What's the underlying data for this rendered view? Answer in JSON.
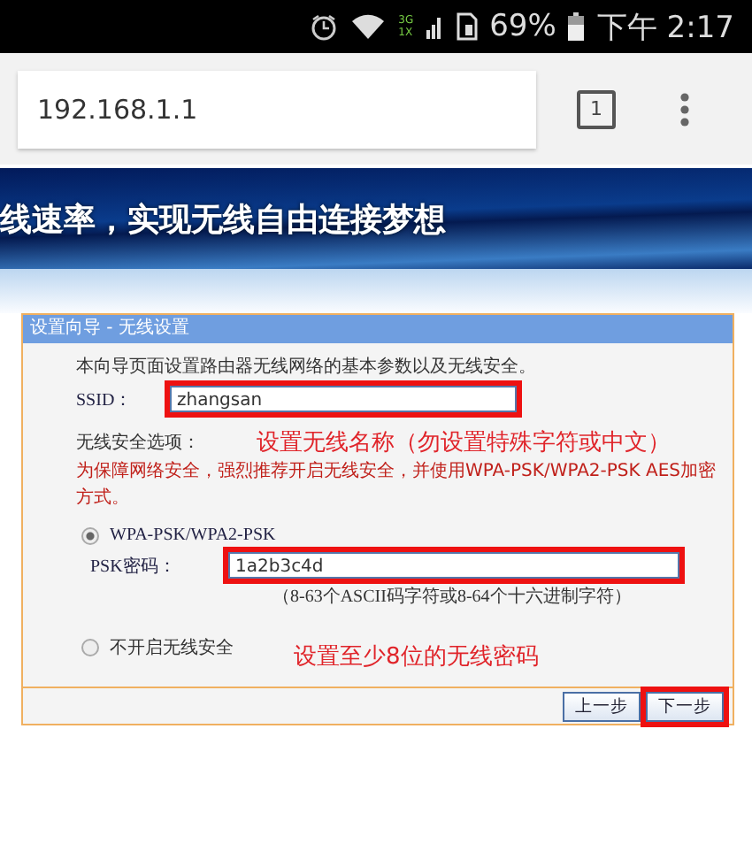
{
  "status_bar": {
    "network_labels": [
      "3G",
      "1X"
    ],
    "battery": "69%",
    "time": "下午 2:17"
  },
  "browser": {
    "url": "192.168.1.1",
    "tab_count": "1"
  },
  "banner": {
    "text": "线速率，实现无线自由连接梦想"
  },
  "panel": {
    "title": "设置向导 - 无线设置",
    "intro": "本向导页面设置路由器无线网络的基本参数以及无线安全。",
    "ssid": {
      "label": "SSID：",
      "value": "zhangsan",
      "highlighted": true
    },
    "security_label": "无线安全选项：",
    "warning": "为保障网络安全，强烈推荐开启无线安全，并使用WPA-PSK/WPA2-PSK AES加密方式。",
    "options": [
      {
        "label": "WPA-PSK/WPA2-PSK",
        "selected": true
      },
      {
        "label": "不开启无线安全",
        "selected": false
      }
    ],
    "psk": {
      "label": "PSK密码：",
      "value": "1a2b3c4d",
      "highlighted": true,
      "hint": "（8-63个ASCII码字符或8-64个十六进制字符）"
    },
    "buttons": [
      {
        "label": "上一步",
        "highlighted": false
      },
      {
        "label": "下一步",
        "highlighted": true
      }
    ]
  },
  "annotations": [
    "设置无线名称（勿设置特殊字符或中文）",
    "设置至少8位的无线密码"
  ]
}
